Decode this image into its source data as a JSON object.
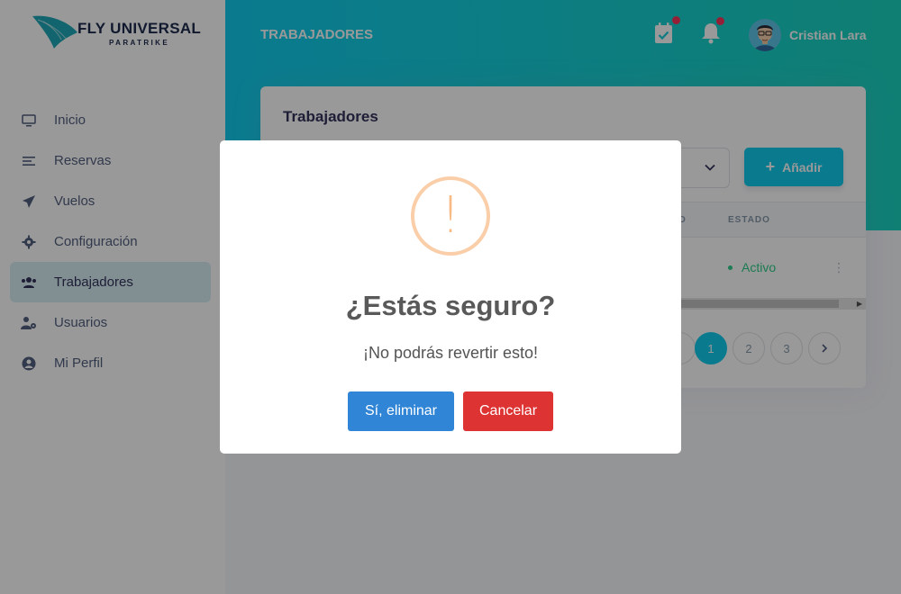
{
  "brand": {
    "title": "FLY UNIVERSAL",
    "subtitle": "PARATRIKE"
  },
  "sidebar": {
    "items": [
      {
        "label": "Inicio",
        "icon": "monitor-icon"
      },
      {
        "label": "Reservas",
        "icon": "list-icon"
      },
      {
        "label": "Vuelos",
        "icon": "paper-plane-icon"
      },
      {
        "label": "Configuración",
        "icon": "gear-icon"
      },
      {
        "label": "Trabajadores",
        "icon": "users-icon",
        "active": true
      },
      {
        "label": "Usuarios",
        "icon": "user-cog-icon"
      },
      {
        "label": "Mi Perfil",
        "icon": "user-circle-icon"
      }
    ]
  },
  "header": {
    "page_title": "TRABAJADORES",
    "user_name": "Cristian Lara",
    "icons": [
      "calendar-check-icon",
      "bell-icon"
    ]
  },
  "card": {
    "title": "Trabajadores",
    "add_button": "Añadir",
    "columns": {
      "partial": "O",
      "estado": "ESTADO"
    },
    "row": {
      "estado": "Activo",
      "actions": "⋮"
    },
    "pagination": {
      "pages": [
        "1",
        "2",
        "3"
      ],
      "active": "1",
      "next": "›"
    }
  },
  "modal": {
    "icon": "warning-icon",
    "icon_glyph": "!",
    "title": "¿Estás seguro?",
    "text": "¡No podrás revertir esto!",
    "confirm_label": "Sí, eliminar",
    "cancel_label": "Cancelar"
  },
  "colors": {
    "primary": "#11cdef",
    "confirm": "#3085d6",
    "cancel": "#dd3333",
    "warning": "#f8bb86",
    "success": "#2dce89",
    "notification_dot": "#f5365c"
  }
}
